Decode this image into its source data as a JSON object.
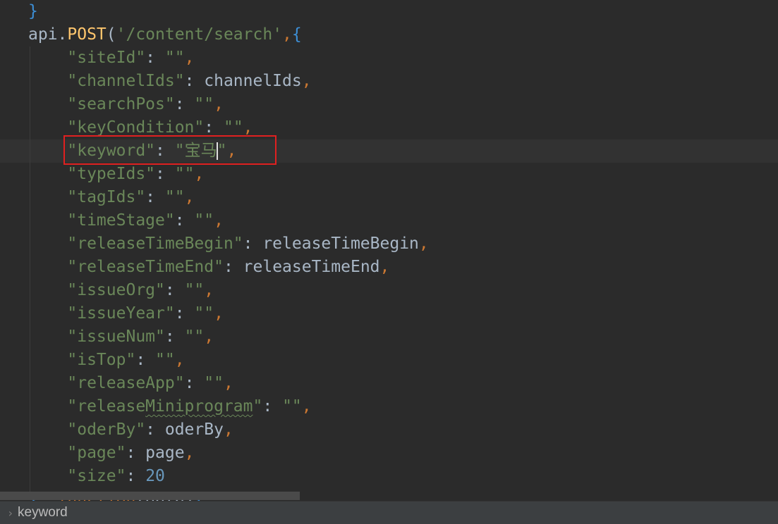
{
  "editor": {
    "lines": [
      {
        "indent": "",
        "parts": [
          {
            "t": "}",
            "c": "b"
          }
        ]
      },
      {
        "indent": "",
        "parts": [
          {
            "t": "api.",
            "c": "plain"
          },
          {
            "t": "POST",
            "c": "f"
          },
          {
            "t": "(",
            "c": "plain"
          },
          {
            "t": "'/content/search'",
            "c": "s"
          },
          {
            "t": ",",
            "c": "p"
          },
          {
            "t": "{",
            "c": "b"
          }
        ]
      },
      {
        "indent": "    ",
        "parts": [
          {
            "t": "\"siteId\"",
            "c": "s"
          },
          {
            "t": ": ",
            "c": "plain"
          },
          {
            "t": "\"\"",
            "c": "s"
          },
          {
            "t": ",",
            "c": "p"
          }
        ]
      },
      {
        "indent": "    ",
        "parts": [
          {
            "t": "\"channelIds\"",
            "c": "s"
          },
          {
            "t": ": channelIds",
            "c": "plain"
          },
          {
            "t": ",",
            "c": "p"
          }
        ]
      },
      {
        "indent": "    ",
        "parts": [
          {
            "t": "\"searchPos\"",
            "c": "s"
          },
          {
            "t": ": ",
            "c": "plain"
          },
          {
            "t": "\"\"",
            "c": "s"
          },
          {
            "t": ",",
            "c": "p"
          }
        ]
      },
      {
        "indent": "    ",
        "parts": [
          {
            "t": "\"keyCondition\"",
            "c": "s"
          },
          {
            "t": ": ",
            "c": "plain"
          },
          {
            "t": "\"\"",
            "c": "s"
          },
          {
            "t": ",",
            "c": "p"
          }
        ]
      },
      {
        "indent": "    ",
        "parts": [
          {
            "t": "\"keyword\"",
            "c": "s"
          },
          {
            "t": ": ",
            "c": "plain"
          },
          {
            "t": "\"宝马",
            "c": "s"
          },
          {
            "t": "",
            "c": "caret"
          },
          {
            "t": "\"",
            "c": "s"
          },
          {
            "t": ",",
            "c": "p"
          }
        ]
      },
      {
        "indent": "    ",
        "parts": [
          {
            "t": "\"typeIds\"",
            "c": "s"
          },
          {
            "t": ": ",
            "c": "plain"
          },
          {
            "t": "\"\"",
            "c": "s"
          },
          {
            "t": ",",
            "c": "p"
          }
        ]
      },
      {
        "indent": "    ",
        "parts": [
          {
            "t": "\"tagIds\"",
            "c": "s"
          },
          {
            "t": ": ",
            "c": "plain"
          },
          {
            "t": "\"\"",
            "c": "s"
          },
          {
            "t": ",",
            "c": "p"
          }
        ]
      },
      {
        "indent": "    ",
        "parts": [
          {
            "t": "\"timeStage\"",
            "c": "s"
          },
          {
            "t": ": ",
            "c": "plain"
          },
          {
            "t": "\"\"",
            "c": "s"
          },
          {
            "t": ",",
            "c": "p"
          }
        ]
      },
      {
        "indent": "    ",
        "parts": [
          {
            "t": "\"releaseTimeBegin\"",
            "c": "s"
          },
          {
            "t": ": releaseTimeBegin",
            "c": "plain"
          },
          {
            "t": ",",
            "c": "p"
          }
        ]
      },
      {
        "indent": "    ",
        "parts": [
          {
            "t": "\"releaseTimeEnd\"",
            "c": "s"
          },
          {
            "t": ": releaseTimeEnd",
            "c": "plain"
          },
          {
            "t": ",",
            "c": "p"
          }
        ]
      },
      {
        "indent": "    ",
        "parts": [
          {
            "t": "\"issueOrg\"",
            "c": "s"
          },
          {
            "t": ": ",
            "c": "plain"
          },
          {
            "t": "\"\"",
            "c": "s"
          },
          {
            "t": ",",
            "c": "p"
          }
        ]
      },
      {
        "indent": "    ",
        "parts": [
          {
            "t": "\"issueYear\"",
            "c": "s"
          },
          {
            "t": ": ",
            "c": "plain"
          },
          {
            "t": "\"\"",
            "c": "s"
          },
          {
            "t": ",",
            "c": "p"
          }
        ]
      },
      {
        "indent": "    ",
        "parts": [
          {
            "t": "\"issueNum\"",
            "c": "s"
          },
          {
            "t": ": ",
            "c": "plain"
          },
          {
            "t": "\"\"",
            "c": "s"
          },
          {
            "t": ",",
            "c": "p"
          }
        ]
      },
      {
        "indent": "    ",
        "parts": [
          {
            "t": "\"isTop\"",
            "c": "s"
          },
          {
            "t": ": ",
            "c": "plain"
          },
          {
            "t": "\"\"",
            "c": "s"
          },
          {
            "t": ",",
            "c": "p"
          }
        ]
      },
      {
        "indent": "    ",
        "parts": [
          {
            "t": "\"releaseApp\"",
            "c": "s"
          },
          {
            "t": ": ",
            "c": "plain"
          },
          {
            "t": "\"\"",
            "c": "s"
          },
          {
            "t": ",",
            "c": "p"
          }
        ]
      },
      {
        "indent": "    ",
        "parts": [
          {
            "t": "\"release",
            "c": "s"
          },
          {
            "t": "Miniprogram",
            "c": "s typo"
          },
          {
            "t": "\"",
            "c": "s"
          },
          {
            "t": ": ",
            "c": "plain"
          },
          {
            "t": "\"\"",
            "c": "s"
          },
          {
            "t": ",",
            "c": "p"
          }
        ]
      },
      {
        "indent": "    ",
        "parts": [
          {
            "t": "\"oderBy\"",
            "c": "s"
          },
          {
            "t": ": oderBy",
            "c": "plain"
          },
          {
            "t": ",",
            "c": "p"
          }
        ]
      },
      {
        "indent": "    ",
        "parts": [
          {
            "t": "\"page\"",
            "c": "s"
          },
          {
            "t": ": page",
            "c": "plain"
          },
          {
            "t": ",",
            "c": "p"
          }
        ]
      },
      {
        "indent": "    ",
        "parts": [
          {
            "t": "\"size\"",
            "c": "s"
          },
          {
            "t": ": ",
            "c": "plain"
          },
          {
            "t": "20",
            "c": "n"
          }
        ]
      },
      {
        "indent": "",
        "parts": [
          {
            "t": "}",
            "c": "b"
          },
          {
            "t": ", ",
            "c": "p"
          },
          {
            "t": "function",
            "c": "k"
          },
          {
            "t": "(data)",
            "c": "plain"
          },
          {
            "t": "{",
            "c": "b"
          }
        ]
      }
    ]
  },
  "breadcrumb": {
    "chevron": "›",
    "label": "keyword"
  }
}
